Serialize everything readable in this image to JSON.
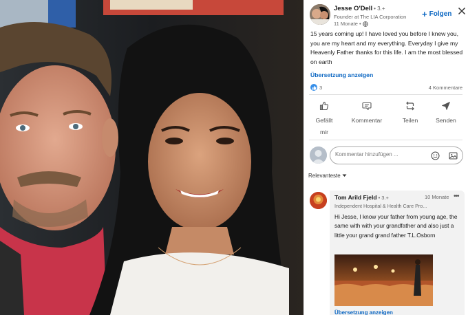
{
  "post": {
    "author": {
      "name": "Jesse O'Dell",
      "degree": "• 3.+",
      "title": "Founder at The LIA Corporation",
      "time": "11 Monate •"
    },
    "follow_label": "Folgen",
    "text": "15 years coming up! I have loved you before I knew you, you are my heart and my everything. Everyday I give my Heavenly Father thanks for this life. I am the most blessed on earth",
    "translate_label": "Übersetzung anzeigen",
    "reaction_count": "3",
    "comment_count": "4 Kommentare"
  },
  "actions": {
    "like": "Gefällt mir",
    "comment": "Kommentar",
    "share": "Teilen",
    "send": "Senden"
  },
  "comment_input": {
    "placeholder": "Kommentar hinzufügen ..."
  },
  "sort_label": "Relevanteste",
  "comments": [
    {
      "name": "Tom Arild Fjeld",
      "degree": "• 3.+",
      "time": "10 Monate",
      "headline": "Independent Hospital & Health Care Pro...",
      "text": "Hi Jesse, I know your father from young age, the same with with your grandfather and also just a little your grand grand father T.L.Osborn",
      "translate_label": "Übersetzung anzeigen"
    }
  ],
  "colors": {
    "accent": "#0a66c2",
    "like": "#378fe9"
  }
}
